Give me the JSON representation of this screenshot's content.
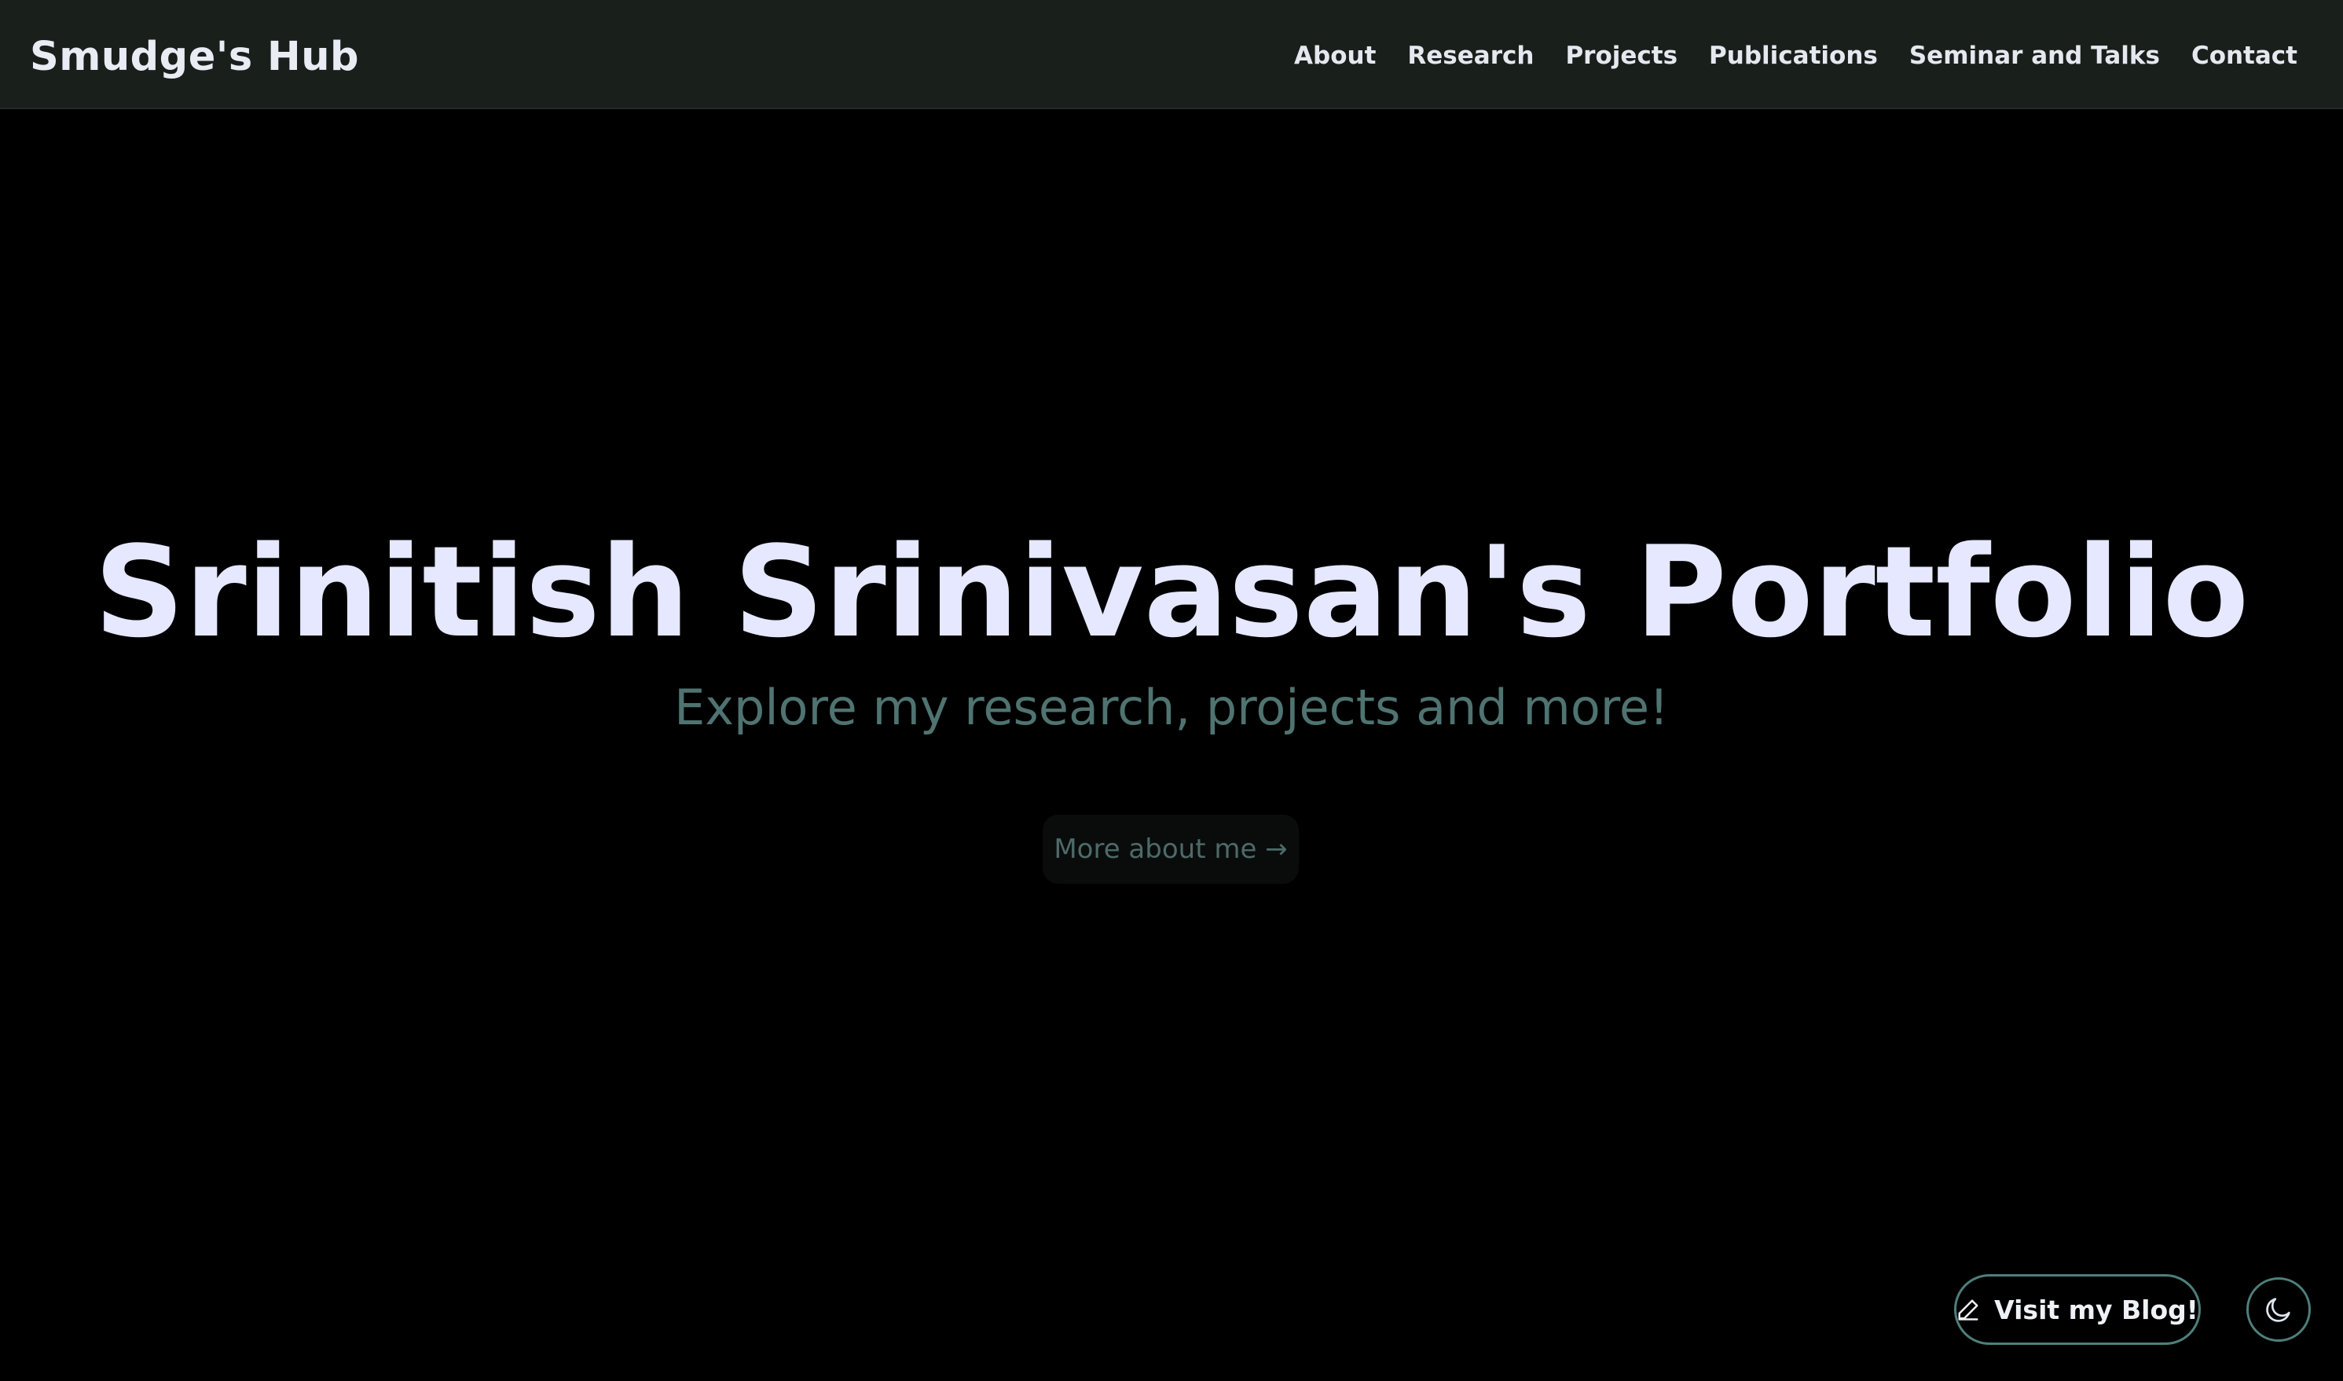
{
  "header": {
    "brand": "Smudge's Hub",
    "nav": [
      {
        "label": "About"
      },
      {
        "label": "Research"
      },
      {
        "label": "Projects"
      },
      {
        "label": "Publications"
      },
      {
        "label": "Seminar and Talks"
      },
      {
        "label": "Contact"
      }
    ]
  },
  "hero": {
    "title": "Srinitish Srinivasan's Portfolio",
    "subtitle": "Explore my research, projects and more!",
    "cta_label": "More about me →"
  },
  "floating": {
    "blog_label": "Visit my Blog!",
    "blog_icon": "pencil-icon",
    "theme_icon": "moon-icon"
  },
  "colors": {
    "background": "#000000",
    "navbar": "#19201c",
    "title": "#e5e8ff",
    "subtitle": "#4f7370",
    "accent_border": "#4e7f7b"
  }
}
